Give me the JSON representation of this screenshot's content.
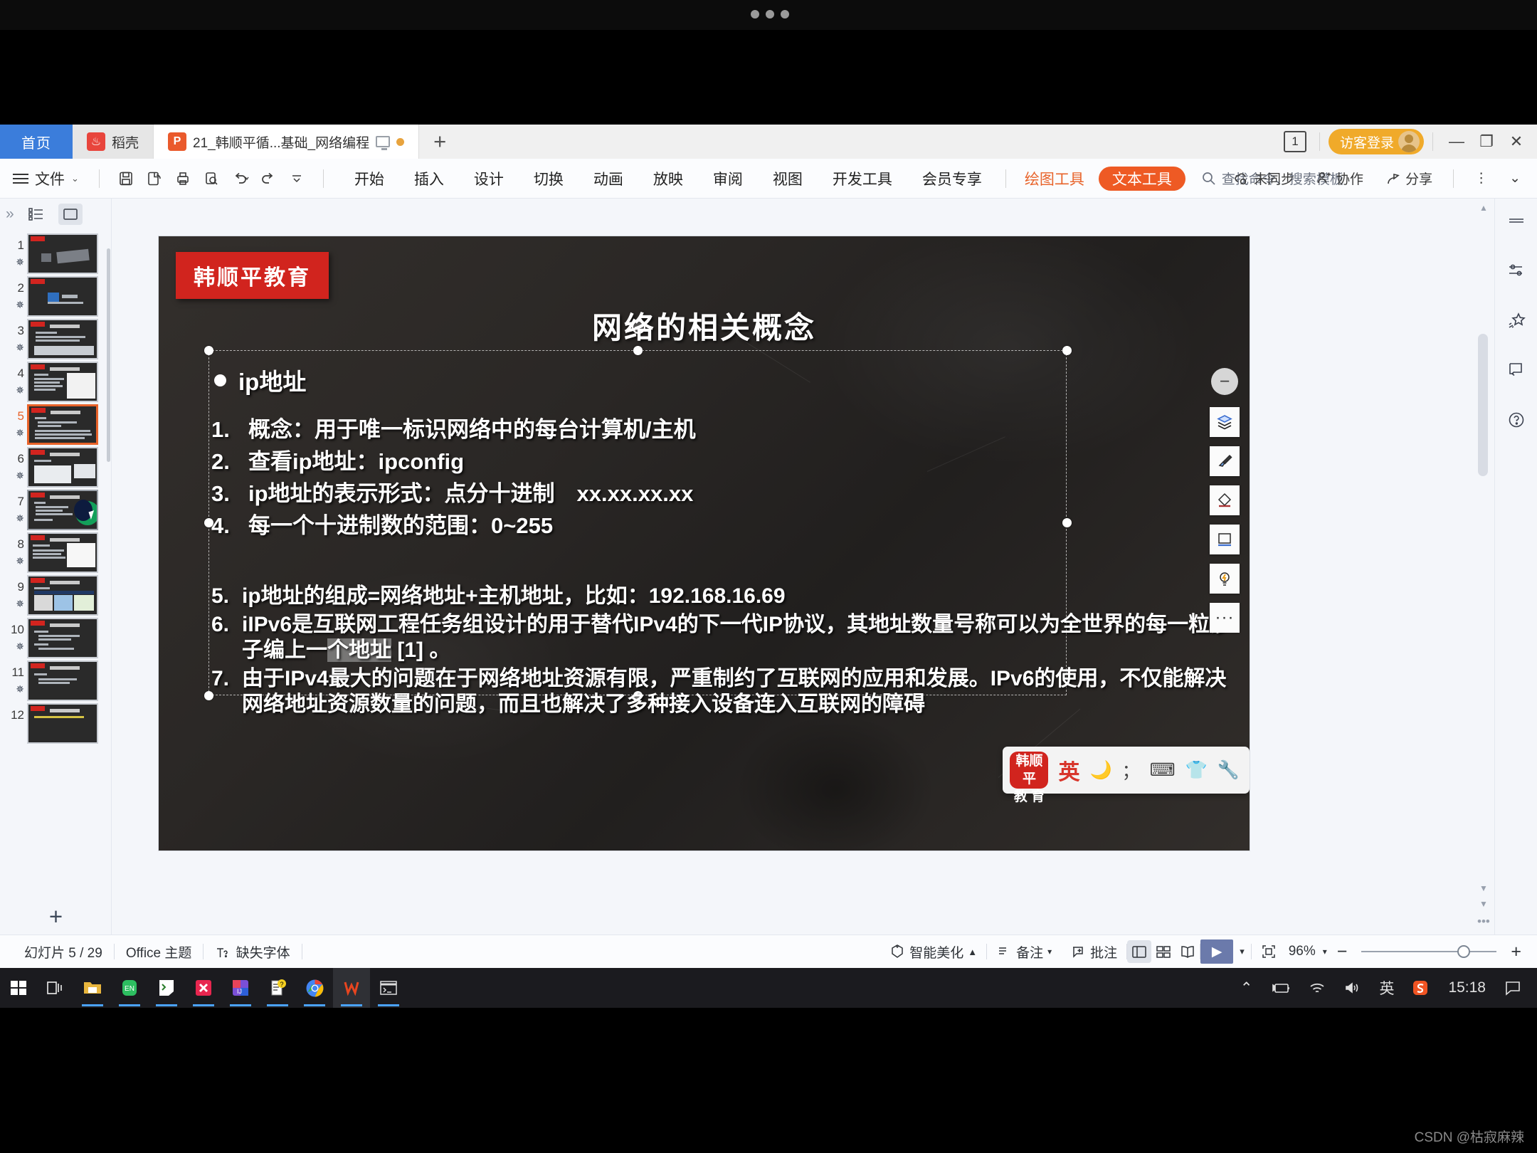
{
  "window": {
    "tabs": [
      {
        "label": "首页",
        "icon": "home-tab"
      },
      {
        "label": "稻壳",
        "icon": "docer-icon"
      },
      {
        "label": "21_韩顺平循...基础_网络编程",
        "icon": "ppt-file-icon"
      }
    ],
    "new_tab_label": "+",
    "window_count_badge": "1",
    "guest_login": "访客登录",
    "minimize": "—",
    "restore": "❐",
    "close": "✕"
  },
  "ribbon": {
    "file_menu": "文件",
    "tabs": [
      "开始",
      "插入",
      "设计",
      "切换",
      "动画",
      "放映",
      "审阅",
      "视图",
      "开发工具",
      "会员专享"
    ],
    "context_tools": [
      {
        "label": "绘图工具",
        "active": false
      },
      {
        "label": "文本工具",
        "active": true
      }
    ],
    "search_placeholder": "查找命令、搜索模板",
    "right_items": [
      {
        "label": "未同步",
        "icon": "cloud-sync-icon"
      },
      {
        "label": "协作",
        "icon": "collaborate-icon"
      },
      {
        "label": "分享",
        "icon": "share-icon"
      }
    ],
    "more_label": "⋮",
    "collapse_label": "⌄"
  },
  "thumbnails": {
    "panel_collapse": "»",
    "view_outline": "outline-view-icon",
    "view_slides": "slide-view-icon",
    "current": 5,
    "items": [
      {
        "num": "1"
      },
      {
        "num": "2"
      },
      {
        "num": "3"
      },
      {
        "num": "4"
      },
      {
        "num": "5"
      },
      {
        "num": "6"
      },
      {
        "num": "7"
      },
      {
        "num": "8"
      },
      {
        "num": "9"
      },
      {
        "num": "10"
      },
      {
        "num": "11"
      },
      {
        "num": "12"
      }
    ],
    "add_slide": "+"
  },
  "slide": {
    "brand_badge": "韩顺平教育",
    "title": "网络的相关概念",
    "bullet_heading": "ip地址",
    "list_upper": [
      {
        "n": "1.",
        "text": "概念：用于唯一标识网络中的每台计算机/主机"
      },
      {
        "n": "2.",
        "text": "查看ip地址：ipconfig"
      },
      {
        "n": "3.",
        "text": "ip地址的表示形式：点分十进制　xx.xx.xx.xx"
      },
      {
        "n": "4.",
        "text": "每一个十进制数的范围：0~255"
      }
    ],
    "list_lower": [
      {
        "n": "5.",
        "text": "ip地址的组成=网络地址+主机地址，比如：192.168.16.69"
      },
      {
        "n": "6.",
        "text": "iIPv6是互联网工程任务组设计的用于替代IPv4的下一代IP协议，其地址数量号称可以为全世界的每一粒沙子编上一个地址 [1] 。",
        "selected_fragment": "个地址"
      },
      {
        "n": "7.",
        "text": "由于IPv4最大的问题在于网络地址资源有限，严重制约了互联网的应用和发展。IPv6的使用，不仅能解决网络地址资源数量的问题，而且也解决了多种接入设备连入互联网的障碍"
      }
    ]
  },
  "float_tools": {
    "collapse": "collapse-minus-icon",
    "items": [
      {
        "icon": "layers-icon"
      },
      {
        "icon": "brush-icon"
      },
      {
        "icon": "shape-style-icon"
      },
      {
        "icon": "frame-icon"
      },
      {
        "icon": "idea-bulb-icon"
      },
      {
        "icon": "more-dots-icon",
        "label": "···"
      }
    ]
  },
  "right_rail": {
    "items": [
      {
        "icon": "panel-handle-icon"
      },
      {
        "icon": "sliders-icon"
      },
      {
        "icon": "magic-star-icon"
      },
      {
        "icon": "present-share-icon"
      },
      {
        "icon": "help-circle-icon"
      }
    ]
  },
  "ime": {
    "logo_line1": "韩顺平",
    "logo_line2": "教 育",
    "mode": "英",
    "icons": [
      "moon-icon",
      "semicolon-icon",
      "keyboard-icon",
      "skin-icon",
      "wrench-icon"
    ]
  },
  "status": {
    "slide_counter": "幻灯片 5 / 29",
    "theme": "Office 主题",
    "missing_font": "缺失字体",
    "beautify": "智能美化",
    "notes": "备注",
    "comments": "批注",
    "views": [
      "normal-view-icon",
      "sorter-view-icon",
      "reading-view-icon"
    ],
    "play": "▶",
    "fit_icon": "fit-screen-icon",
    "zoom": "96%",
    "zoom_out": "−",
    "zoom_in": "+"
  },
  "taskbar": {
    "apps": [
      {
        "icon": "windows-start-icon"
      },
      {
        "icon": "task-view-icon"
      },
      {
        "icon": "file-explorer-icon"
      },
      {
        "icon": "evernote-icon"
      },
      {
        "icon": "cmder-icon"
      },
      {
        "icon": "xmind-icon"
      },
      {
        "icon": "intellij-idea-icon"
      },
      {
        "icon": "notepad-help-icon"
      },
      {
        "icon": "chrome-icon"
      },
      {
        "icon": "wps-icon"
      },
      {
        "icon": "terminal-icon"
      }
    ],
    "tray": [
      "chevron-up-icon",
      "battery-charging-icon",
      "wifi-icon",
      "volume-icon"
    ],
    "ime_mode": "英",
    "sogou_icon": "sogou-icon",
    "clock": "15:18",
    "notification": "notification-icon"
  },
  "watermark": "CSDN @枯寂麻辣",
  "colors": {
    "accent_blue": "#3b7ddb",
    "accent_orange": "#ee5a24",
    "brand_red": "#d1241e",
    "guest_amber": "#f0aa2a"
  }
}
